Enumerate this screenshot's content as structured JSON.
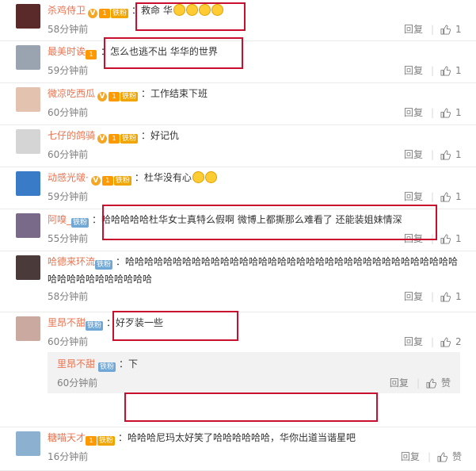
{
  "comments": [
    {
      "name": "杀鸡侍卫",
      "badge": "铁粉",
      "has_v": true,
      "level": "1",
      "text": "救命 华",
      "emoji_count": 4,
      "time": "58分钟前",
      "reply": "回复",
      "likes": "1",
      "avatar_color": "#5a2a2a"
    },
    {
      "name": "最美时诶",
      "badge": "",
      "has_v": false,
      "level": "1",
      "text": "怎么也逃不出 华华的世界",
      "emoji_count": 0,
      "time": "59分钟前",
      "reply": "回复",
      "likes": "1",
      "avatar_color": "#9aa3b0"
    },
    {
      "name": "微凉吃西瓜",
      "badge": "铁粉",
      "has_v": true,
      "level": "1",
      "text": "工作结束下班",
      "emoji_count": 0,
      "time": "60分钟前",
      "reply": "回复",
      "likes": "1",
      "avatar_color": "#e3c2b0"
    },
    {
      "name": "七仔的鸽骑",
      "badge": "铁粉",
      "has_v": true,
      "level": "1",
      "text": "好记仇",
      "emoji_count": 0,
      "time": "60分钟前",
      "reply": "回复",
      "likes": "1",
      "avatar_color": "#d5d5d5"
    },
    {
      "name": "动感光啵·",
      "badge": "铁粉",
      "has_v": true,
      "level": "1",
      "text": "杜华没有心",
      "emoji_count": 2,
      "time": "59分钟前",
      "reply": "回复",
      "likes": "1",
      "avatar_color": "#3a7bc8"
    },
    {
      "name": "阿嗅_",
      "badge": "铁粉",
      "has_v": false,
      "level": "",
      "text": "哈哈哈哈哈杜华女士真特么假啊  微博上都撕那么难看了 还能装姐妹情深",
      "emoji_count": 0,
      "time": "55分钟前",
      "reply": "回复",
      "likes": "1",
      "avatar_color": "#7a6a8a"
    },
    {
      "name": "哈德来环流",
      "badge": "铁粉",
      "has_v": false,
      "level": "",
      "text": "哈哈哈哈哈哈哈哈哈哈哈哈哈哈哈哈哈哈哈哈哈哈哈哈哈哈哈哈哈哈哈哈哈哈哈哈哈哈哈哈哈哈哈哈哈哈",
      "emoji_count": 0,
      "time": "58分钟前",
      "reply": "回复",
      "likes": "1",
      "avatar_color": "#4b3a3a"
    },
    {
      "name": "里昂不甜",
      "badge": "铁粉",
      "has_v": false,
      "level": "",
      "text": "好歹装一些",
      "emoji_count": 0,
      "time": "60分钟前",
      "reply": "回复",
      "likes": "2",
      "avatar_color": "#caa9a0",
      "sub_reply": {
        "name": "里昂不甜",
        "badge": "铁粉",
        "text": "下",
        "time": "60分钟前",
        "reply": "回复",
        "like_label": "赞"
      }
    },
    {
      "name": "糖喵天才",
      "badge": "铁粉",
      "has_v": false,
      "level": "1",
      "text": "哈哈哈尼玛太好笑了哈哈哈哈哈哈，华你出道当谐星吧",
      "emoji_count": 0,
      "time": "16分钟前",
      "reply": "回复",
      "likes": "赞",
      "avatar_color": "#8bb0d0"
    }
  ],
  "colors": {
    "username": "#eb7350",
    "highlight_box": "#c8102e",
    "meta_text": "#808080"
  }
}
